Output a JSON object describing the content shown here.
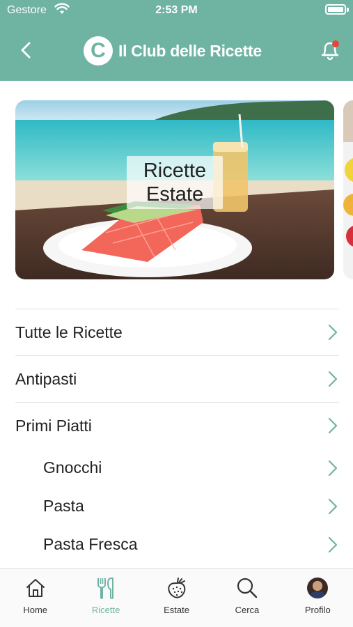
{
  "status_bar": {
    "carrier": "Gestore",
    "time": "2:53 PM"
  },
  "header": {
    "logo_letter": "C",
    "title": "Il Club delle Ricette",
    "accent_color": "#6fb3a3",
    "notification_dot_color": "#e8443a"
  },
  "banner": {
    "label": "Ricette Estate"
  },
  "menu": {
    "items": [
      {
        "label": "Tutte le Ricette",
        "level": 0
      },
      {
        "label": "Antipasti",
        "level": 0
      },
      {
        "label": "Primi Piatti",
        "level": 0
      },
      {
        "label": "Gnocchi",
        "level": 1
      },
      {
        "label": "Pasta",
        "level": 1
      },
      {
        "label": "Pasta Fresca",
        "level": 1
      }
    ]
  },
  "tabbar": {
    "tabs": [
      {
        "label": "Home",
        "icon": "home-icon"
      },
      {
        "label": "Ricette",
        "icon": "cutlery-icon",
        "active": true
      },
      {
        "label": "Estate",
        "icon": "strawberry-icon"
      },
      {
        "label": "Cerca",
        "icon": "search-icon"
      },
      {
        "label": "Profilo",
        "icon": "avatar"
      }
    ]
  }
}
